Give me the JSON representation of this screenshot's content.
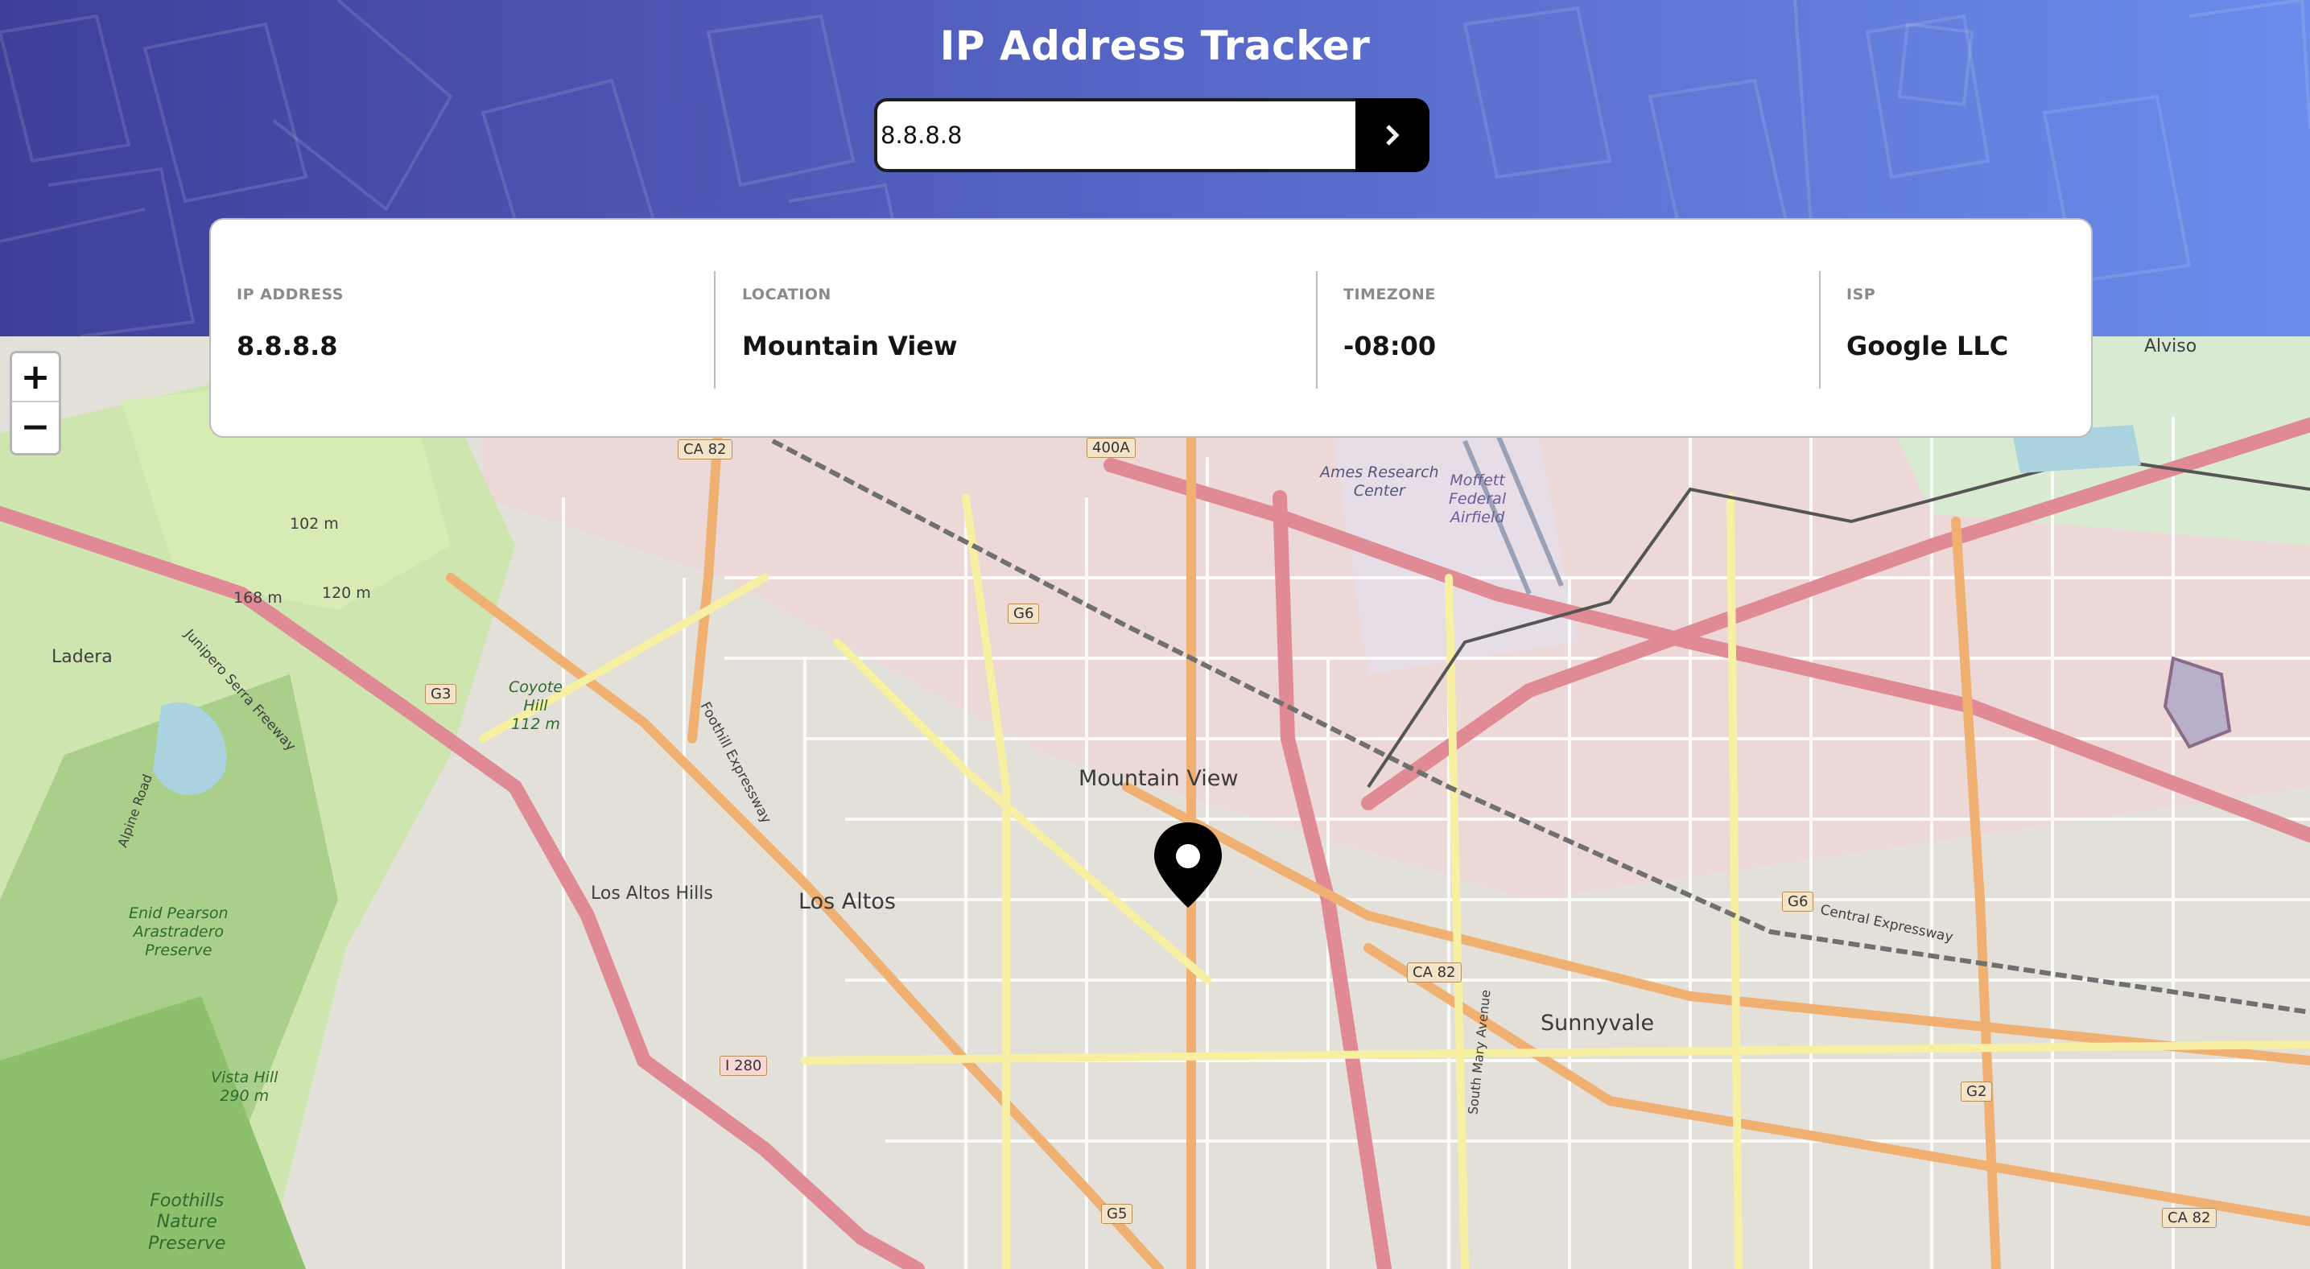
{
  "app": {
    "title": "IP Address Tracker"
  },
  "search": {
    "value": "8.8.8.8",
    "button_icon": "chevron-right-icon"
  },
  "info": {
    "ip": {
      "label": "IP ADDRESS",
      "value": "8.8.8.8"
    },
    "location": {
      "label": "LOCATION",
      "value": "Mountain View"
    },
    "timezone": {
      "label": "TIMEZONE",
      "value": "-08:00"
    },
    "isp": {
      "label": "ISP",
      "value": "Google LLC"
    }
  },
  "map_controls": {
    "zoom_in": "+",
    "zoom_out": "−"
  },
  "map_labels": {
    "mountain_view": "Mountain View",
    "sunnyvale": "Sunnyvale",
    "los_altos": "Los Altos",
    "los_altos_hills": "Los Altos Hills",
    "ladera": "Ladera",
    "alviso": "Alviso",
    "coyote_hill": "Coyote\nHill\n112 m",
    "ames": "Ames Research\nCenter",
    "moffett": "Moffett\nFederal\nAirfield",
    "enid": "Enid Pearson\nArastradero\nPreserve",
    "vista_hill": "Vista Hill\n290 m",
    "foothills": "Foothills\nNature\nPreserve",
    "peak_102": "102 m",
    "peak_168": "168 m",
    "peak_120": "120 m",
    "junipero": "Junipero Serra Freeway",
    "foothill_expressway": "Foothill Expressway",
    "central_expressway": "Central Expressway",
    "south_mary": "South Mary Avenue",
    "alpine_road": "Alpine Road"
  },
  "road_shields": {
    "ca82_top": "CA 82",
    "ca82_mid": "CA 82",
    "ca82_right": "CA 82",
    "i280": "I 280",
    "g3": "G3",
    "g6_top": "G6",
    "g6_right": "G6",
    "g5": "G5",
    "g2": "G2",
    "r400a": "400A"
  },
  "colors": {
    "header_start": "#3f3f99",
    "header_end": "#6a8cea",
    "accent": "#000000"
  }
}
